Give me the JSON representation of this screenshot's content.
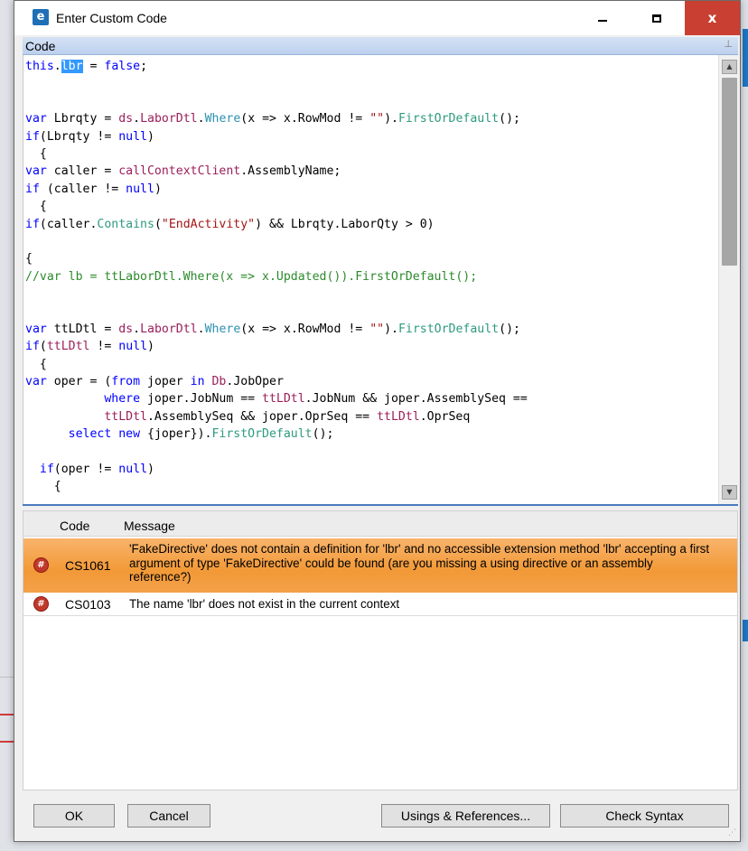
{
  "window": {
    "title": "Enter Custom Code",
    "app_icon": "e",
    "controls": {
      "minimize_icon": "minimize-icon",
      "maximize_icon": "maximize-icon",
      "close_label": "x"
    }
  },
  "code_panel": {
    "header": "Code",
    "pin_icon": "p",
    "lines": [
      [
        [
          "kw",
          "this"
        ],
        [
          "",
          "."
        ],
        [
          "sel",
          "lbr"
        ],
        [
          "",
          " = "
        ],
        [
          "kw",
          "false"
        ],
        [
          "",
          ";"
        ]
      ],
      [],
      [],
      [
        [
          "kw",
          "var"
        ],
        [
          "",
          " Lbrqty = "
        ],
        [
          "mem",
          "ds"
        ],
        [
          "",
          "."
        ],
        [
          "mem",
          "LaborDtl"
        ],
        [
          "",
          "."
        ],
        [
          "ty",
          "Where"
        ],
        [
          "",
          "(x => x.RowMod != "
        ],
        [
          "st",
          "\"\""
        ],
        [
          "",
          ")."
        ],
        [
          "me",
          "FirstOrDefault"
        ],
        [
          "",
          "();"
        ]
      ],
      [
        [
          "kw",
          "if"
        ],
        [
          "",
          "(Lbrqty != "
        ],
        [
          "kw",
          "null"
        ],
        [
          "",
          ")"
        ]
      ],
      [
        [
          "",
          "  {"
        ]
      ],
      [
        [
          "kw",
          "var"
        ],
        [
          "",
          " caller = "
        ],
        [
          "mem",
          "callContextClient"
        ],
        [
          "",
          ".AssemblyName;"
        ]
      ],
      [
        [
          "kw",
          "if"
        ],
        [
          "",
          " (caller != "
        ],
        [
          "kw",
          "null"
        ],
        [
          "",
          ")"
        ]
      ],
      [
        [
          "",
          "  {"
        ]
      ],
      [
        [
          "kw",
          "if"
        ],
        [
          "",
          "(caller."
        ],
        [
          "me",
          "Contains"
        ],
        [
          "",
          "("
        ],
        [
          "st",
          "\"EndActivity\""
        ],
        [
          "",
          ") && Lbrqty.LaborQty > 0)"
        ]
      ],
      [],
      [
        [
          "",
          "{"
        ]
      ],
      [
        [
          "cm",
          "//var lb = ttLaborDtl.Where(x => x.Updated()).FirstOrDefault();"
        ]
      ],
      [],
      [],
      [
        [
          "kw",
          "var"
        ],
        [
          "",
          " ttLDtl = "
        ],
        [
          "mem",
          "ds"
        ],
        [
          "",
          "."
        ],
        [
          "mem",
          "LaborDtl"
        ],
        [
          "",
          "."
        ],
        [
          "ty",
          "Where"
        ],
        [
          "",
          "(x => x.RowMod != "
        ],
        [
          "st",
          "\"\""
        ],
        [
          "",
          ")."
        ],
        [
          "me",
          "FirstOrDefault"
        ],
        [
          "",
          "();"
        ]
      ],
      [
        [
          "kw",
          "if"
        ],
        [
          "",
          "("
        ],
        [
          "mem",
          "ttLDtl"
        ],
        [
          "",
          " != "
        ],
        [
          "kw",
          "null"
        ],
        [
          "",
          ")"
        ]
      ],
      [
        [
          "",
          "  {"
        ]
      ],
      [
        [
          "kw",
          "var"
        ],
        [
          "",
          " oper = ("
        ],
        [
          "kw",
          "from"
        ],
        [
          "",
          " joper "
        ],
        [
          "kw",
          "in"
        ],
        [
          "",
          " "
        ],
        [
          "mem",
          "Db"
        ],
        [
          "",
          ".JobOper"
        ]
      ],
      [
        [
          "",
          "           "
        ],
        [
          "kw",
          "where"
        ],
        [
          "",
          " joper.JobNum == "
        ],
        [
          "mem",
          "ttLDtl"
        ],
        [
          "",
          ".JobNum && joper.AssemblySeq =="
        ]
      ],
      [
        [
          "",
          "           "
        ],
        [
          "mem",
          "ttLDtl"
        ],
        [
          "",
          ".AssemblySeq && joper.OprSeq == "
        ],
        [
          "mem",
          "ttLDtl"
        ],
        [
          "",
          ".OprSeq"
        ]
      ],
      [
        [
          "",
          "      "
        ],
        [
          "kw",
          "select"
        ],
        [
          "",
          " "
        ],
        [
          "kw",
          "new"
        ],
        [
          "",
          " {joper})."
        ],
        [
          "me",
          "FirstOrDefault"
        ],
        [
          "",
          "();"
        ]
      ],
      [],
      [
        [
          "",
          "  "
        ],
        [
          "kw",
          "if"
        ],
        [
          "",
          "(oper != "
        ],
        [
          "kw",
          "null"
        ],
        [
          "",
          ")"
        ]
      ],
      [
        [
          "",
          "    {"
        ]
      ]
    ]
  },
  "errors": {
    "columns": {
      "code": "Code",
      "message": "Message"
    },
    "rows": [
      {
        "icon": "#",
        "code": "CS1061",
        "message": "'FakeDirective' does not contain a definition for 'lbr' and no accessible extension method 'lbr' accepting a first argument of type 'FakeDirective' could be found (are you missing a using directive or an assembly reference?)",
        "selected": true
      },
      {
        "icon": "#",
        "code": "CS0103",
        "message": "The name 'lbr' does not exist in the current context",
        "selected": false
      }
    ]
  },
  "buttons": {
    "ok": "OK",
    "cancel": "Cancel",
    "usings": "Usings & References...",
    "check": "Check Syntax"
  },
  "colors": {
    "keyword": "#0000ff",
    "type": "#2b91af",
    "comment": "#2b8a2b",
    "string": "#a31515",
    "selection": "#3399ff",
    "error_row": "#f29937",
    "close_button": "#c94032"
  }
}
